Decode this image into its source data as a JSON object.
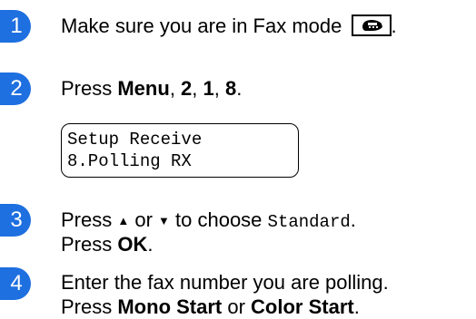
{
  "steps": [
    {
      "number": "1",
      "text": "Make sure you are in Fax mode",
      "icon": "fax-icon"
    },
    {
      "number": "2",
      "pre": "Press ",
      "menu": "Menu",
      "sep1": ", ",
      "k1": "2",
      "sep2": ", ",
      "k2": "1",
      "sep3": ", ",
      "k3": "8",
      "end": "."
    },
    {
      "number": "3",
      "pre": "Press ",
      "up": "▲",
      "or": " or ",
      "down": "▼",
      "mid": " to choose ",
      "option": "Standard",
      "end": ".",
      "line2_pre": "Press ",
      "ok": "OK",
      "line2_end": "."
    },
    {
      "number": "4",
      "line1": "Enter the fax number you are polling.",
      "pre": "Press ",
      "mono_start": "Mono Start",
      "or": " or ",
      "color_start": "Color Start",
      "end": "."
    }
  ],
  "lcd": {
    "line1": "Setup Receive",
    "line2": "8.Polling RX"
  }
}
